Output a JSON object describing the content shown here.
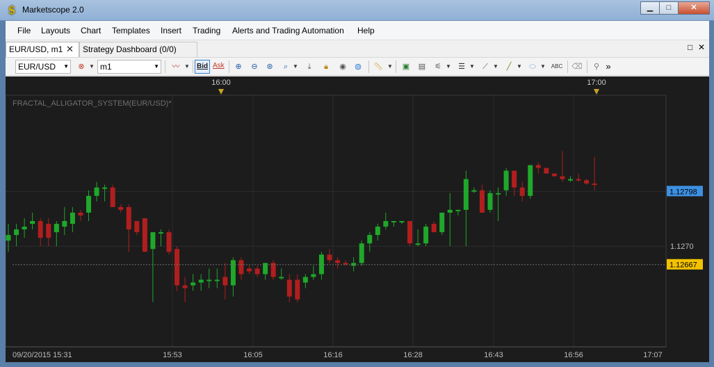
{
  "window": {
    "title": "Marketscope 2.0",
    "app_icon_glyph": "$",
    "minimize": "▁",
    "maximize": "□",
    "close": "✕"
  },
  "menu": [
    "File",
    "Layouts",
    "Chart",
    "Templates",
    "Insert",
    "Trading",
    "Alerts and Trading Automation",
    "Help"
  ],
  "tabs": {
    "active": "EUR/USD, m1",
    "active_close": "✕",
    "inactive": "Strategy Dashboard (0/0)",
    "restore_glyph": "□",
    "close_glyph": "✕"
  },
  "toolbar": {
    "instrument": "EUR/USD",
    "timeframe": "m1",
    "bid_label": "Bid",
    "ask_label": "Ask",
    "more_glyph": "»"
  },
  "chart": {
    "indicator_label": "FRACTAL_ALLIGATOR_SYSTEM(EUR/USD)*",
    "top_time_labels": [
      "16:00",
      "17:00"
    ],
    "bottom_time_labels": [
      "09/20/2015 15:31",
      "15:53",
      "16:05",
      "16:16",
      "16:28",
      "16:43",
      "16:56",
      "17:07"
    ],
    "price_axis_label": "1.1270",
    "current_price_label": "1.12798",
    "level_price_label": "1.12667",
    "current_price_color": "#3d8fe0",
    "level_price_color": "#f2c200",
    "up_color": "#1fa82a",
    "down_color": "#b11e1e"
  },
  "chart_data": {
    "type": "candlestick",
    "symbol": "EUR/USD",
    "timeframe": "m1",
    "title": "FRACTAL_ALLIGATOR_SYSTEM(EUR/USD)*",
    "x_tick_labels": [
      "09/20/2015 15:31",
      "15:53",
      "16:05",
      "16:16",
      "16:28",
      "16:43",
      "16:56",
      "17:07"
    ],
    "y_tick_labels": [
      "1.1270"
    ],
    "ylim": [
      1.1252,
      1.1297
    ],
    "markers": {
      "current_price": 1.12798,
      "level": 1.12667
    },
    "candles": [
      {
        "o": 1.1271,
        "h": 1.1274,
        "l": 1.1269,
        "c": 1.1272
      },
      {
        "o": 1.1272,
        "h": 1.1274,
        "l": 1.127,
        "c": 1.1273
      },
      {
        "o": 1.1273,
        "h": 1.1275,
        "l": 1.12715,
        "c": 1.12735
      },
      {
        "o": 1.1274,
        "h": 1.1276,
        "l": 1.1273,
        "c": 1.12745
      },
      {
        "o": 1.12745,
        "h": 1.1275,
        "l": 1.127,
        "c": 1.12715
      },
      {
        "o": 1.1274,
        "h": 1.1275,
        "l": 1.127,
        "c": 1.12715
      },
      {
        "o": 1.12725,
        "h": 1.12745,
        "l": 1.127,
        "c": 1.1274
      },
      {
        "o": 1.12735,
        "h": 1.1277,
        "l": 1.1272,
        "c": 1.12745
      },
      {
        "o": 1.1274,
        "h": 1.1277,
        "l": 1.12725,
        "c": 1.1276
      },
      {
        "o": 1.1276,
        "h": 1.12765,
        "l": 1.12745,
        "c": 1.12755
      },
      {
        "o": 1.1276,
        "h": 1.128,
        "l": 1.12745,
        "c": 1.1279
      },
      {
        "o": 1.1279,
        "h": 1.12815,
        "l": 1.1278,
        "c": 1.12805
      },
      {
        "o": 1.12803,
        "h": 1.1281,
        "l": 1.1278,
        "c": 1.12805
      },
      {
        "o": 1.12805,
        "h": 1.1281,
        "l": 1.1277,
        "c": 1.1277
      },
      {
        "o": 1.1277,
        "h": 1.12775,
        "l": 1.1276,
        "c": 1.12765
      },
      {
        "o": 1.1277,
        "h": 1.12775,
        "l": 1.1269,
        "c": 1.1273
      },
      {
        "o": 1.12745,
        "h": 1.12745,
        "l": 1.1272,
        "c": 1.12725
      },
      {
        "o": 1.1275,
        "h": 1.1275,
        "l": 1.1269,
        "c": 1.1269
      },
      {
        "o": 1.12695,
        "h": 1.12725,
        "l": 1.126,
        "c": 1.12725
      },
      {
        "o": 1.12725,
        "h": 1.1273,
        "l": 1.127,
        "c": 1.12725
      },
      {
        "o": 1.12725,
        "h": 1.1273,
        "l": 1.12685,
        "c": 1.1269
      },
      {
        "o": 1.12695,
        "h": 1.127,
        "l": 1.1262,
        "c": 1.1263
      },
      {
        "o": 1.1263,
        "h": 1.12645,
        "l": 1.126,
        "c": 1.12625
      },
      {
        "o": 1.1263,
        "h": 1.1265,
        "l": 1.1262,
        "c": 1.12635
      },
      {
        "o": 1.12635,
        "h": 1.1265,
        "l": 1.1262,
        "c": 1.1264
      },
      {
        "o": 1.1264,
        "h": 1.1266,
        "l": 1.12625,
        "c": 1.1264
      },
      {
        "o": 1.1264,
        "h": 1.1266,
        "l": 1.12625,
        "c": 1.1264
      },
      {
        "o": 1.12645,
        "h": 1.1267,
        "l": 1.12605,
        "c": 1.1263
      },
      {
        "o": 1.1263,
        "h": 1.1268,
        "l": 1.1261,
        "c": 1.12675
      },
      {
        "o": 1.12675,
        "h": 1.1268,
        "l": 1.1264,
        "c": 1.1265
      },
      {
        "o": 1.1266,
        "h": 1.12665,
        "l": 1.1265,
        "c": 1.12655
      },
      {
        "o": 1.1266,
        "h": 1.12665,
        "l": 1.12645,
        "c": 1.1265
      },
      {
        "o": 1.1265,
        "h": 1.1267,
        "l": 1.1264,
        "c": 1.1267
      },
      {
        "o": 1.1267,
        "h": 1.12675,
        "l": 1.1264,
        "c": 1.12645
      },
      {
        "o": 1.12645,
        "h": 1.1266,
        "l": 1.1264,
        "c": 1.12645
      },
      {
        "o": 1.1264,
        "h": 1.1265,
        "l": 1.126,
        "c": 1.1261
      },
      {
        "o": 1.1264,
        "h": 1.1265,
        "l": 1.126,
        "c": 1.12605
      },
      {
        "o": 1.12635,
        "h": 1.1265,
        "l": 1.12625,
        "c": 1.12645
      },
      {
        "o": 1.12645,
        "h": 1.12665,
        "l": 1.1264,
        "c": 1.1265
      },
      {
        "o": 1.1265,
        "h": 1.1269,
        "l": 1.1264,
        "c": 1.12685
      },
      {
        "o": 1.12685,
        "h": 1.12695,
        "l": 1.1267,
        "c": 1.12675
      },
      {
        "o": 1.12675,
        "h": 1.1268,
        "l": 1.1266,
        "c": 1.1267
      },
      {
        "o": 1.1267,
        "h": 1.12675,
        "l": 1.12665,
        "c": 1.12668
      },
      {
        "o": 1.12665,
        "h": 1.1268,
        "l": 1.12655,
        "c": 1.1267
      },
      {
        "o": 1.1267,
        "h": 1.1271,
        "l": 1.12665,
        "c": 1.12705
      },
      {
        "o": 1.12705,
        "h": 1.12725,
        "l": 1.1269,
        "c": 1.1272
      },
      {
        "o": 1.1272,
        "h": 1.1274,
        "l": 1.1271,
        "c": 1.12735
      },
      {
        "o": 1.12735,
        "h": 1.1276,
        "l": 1.1273,
        "c": 1.12745
      },
      {
        "o": 1.12745,
        "h": 1.12745,
        "l": 1.12735,
        "c": 1.12745
      },
      {
        "o": 1.12745,
        "h": 1.12745,
        "l": 1.1274,
        "c": 1.12745
      },
      {
        "o": 1.12745,
        "h": 1.12745,
        "l": 1.127,
        "c": 1.12705
      },
      {
        "o": 1.12705,
        "h": 1.1273,
        "l": 1.127,
        "c": 1.12705
      },
      {
        "o": 1.12705,
        "h": 1.1274,
        "l": 1.127,
        "c": 1.12735
      },
      {
        "o": 1.1274,
        "h": 1.12745,
        "l": 1.12725,
        "c": 1.12725
      },
      {
        "o": 1.12725,
        "h": 1.1276,
        "l": 1.1272,
        "c": 1.1276
      },
      {
        "o": 1.1276,
        "h": 1.12795,
        "l": 1.127,
        "c": 1.12765
      },
      {
        "o": 1.12765,
        "h": 1.12765,
        "l": 1.12755,
        "c": 1.12765
      },
      {
        "o": 1.12765,
        "h": 1.12835,
        "l": 1.127,
        "c": 1.1282
      },
      {
        "o": 1.128,
        "h": 1.12805,
        "l": 1.12795,
        "c": 1.128
      },
      {
        "o": 1.128,
        "h": 1.1281,
        "l": 1.1276,
        "c": 1.1276
      },
      {
        "o": 1.12765,
        "h": 1.128,
        "l": 1.1276,
        "c": 1.12795
      },
      {
        "o": 1.12795,
        "h": 1.12805,
        "l": 1.12745,
        "c": 1.12795
      },
      {
        "o": 1.128,
        "h": 1.1284,
        "l": 1.1279,
        "c": 1.12835
      },
      {
        "o": 1.12835,
        "h": 1.12835,
        "l": 1.1279,
        "c": 1.12805
      },
      {
        "o": 1.12805,
        "h": 1.12815,
        "l": 1.1278,
        "c": 1.1279
      },
      {
        "o": 1.1279,
        "h": 1.12845,
        "l": 1.12785,
        "c": 1.12845
      },
      {
        "o": 1.12845,
        "h": 1.1285,
        "l": 1.1283,
        "c": 1.1284
      },
      {
        "o": 1.1284,
        "h": 1.1284,
        "l": 1.1283,
        "c": 1.1283
      },
      {
        "o": 1.1283,
        "h": 1.1283,
        "l": 1.12825,
        "c": 1.12825
      },
      {
        "o": 1.12825,
        "h": 1.1287,
        "l": 1.12815,
        "c": 1.1282
      },
      {
        "o": 1.1282,
        "h": 1.12825,
        "l": 1.12815,
        "c": 1.1282
      },
      {
        "o": 1.1282,
        "h": 1.1283,
        "l": 1.12815,
        "c": 1.12818
      },
      {
        "o": 1.12818,
        "h": 1.1282,
        "l": 1.1281,
        "c": 1.12812
      },
      {
        "o": 1.12812,
        "h": 1.1286,
        "l": 1.128,
        "c": 1.1281
      }
    ]
  }
}
